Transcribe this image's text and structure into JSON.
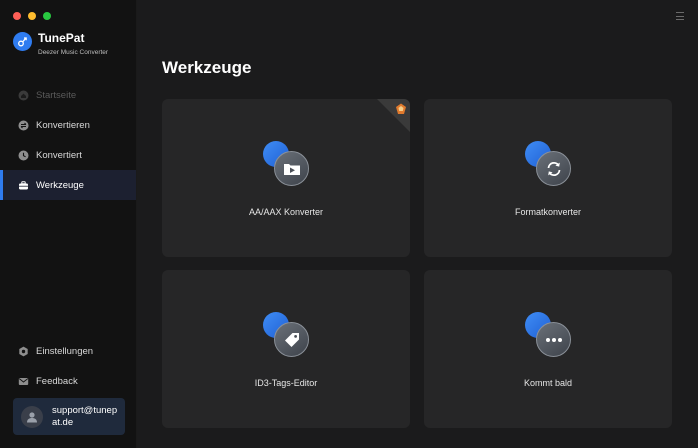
{
  "app": {
    "name": "TunePat",
    "subtitle": "Deezer Music Converter"
  },
  "sidebar": {
    "items": [
      {
        "label": "Startseite",
        "icon": "home-icon",
        "state": "disabled"
      },
      {
        "label": "Konvertieren",
        "icon": "convert-icon",
        "state": "normal"
      },
      {
        "label": "Konvertiert",
        "icon": "clock-icon",
        "state": "normal"
      },
      {
        "label": "Werkzeuge",
        "icon": "toolbox-icon",
        "state": "active"
      }
    ],
    "bottom_items": [
      {
        "label": "Einstellungen",
        "icon": "settings-icon"
      },
      {
        "label": "Feedback",
        "icon": "mail-icon"
      }
    ],
    "account_email": "support@tunepat.de"
  },
  "main": {
    "title": "Werkzeuge",
    "tools": [
      {
        "label": "AA/AAX Konverter",
        "icon": "play-folder-icon"
      },
      {
        "label": "Formatkonverter",
        "icon": "refresh-icon"
      },
      {
        "label": "ID3-Tags-Editor",
        "icon": "tag-icon"
      },
      {
        "label": "Kommt bald",
        "icon": "more-icon"
      }
    ]
  },
  "colors": {
    "accent": "#2f7cf0",
    "sidebar_bg": "#121212",
    "main_bg": "#1b1b1c",
    "card_bg": "#262627",
    "badge": "#e07a2e"
  }
}
